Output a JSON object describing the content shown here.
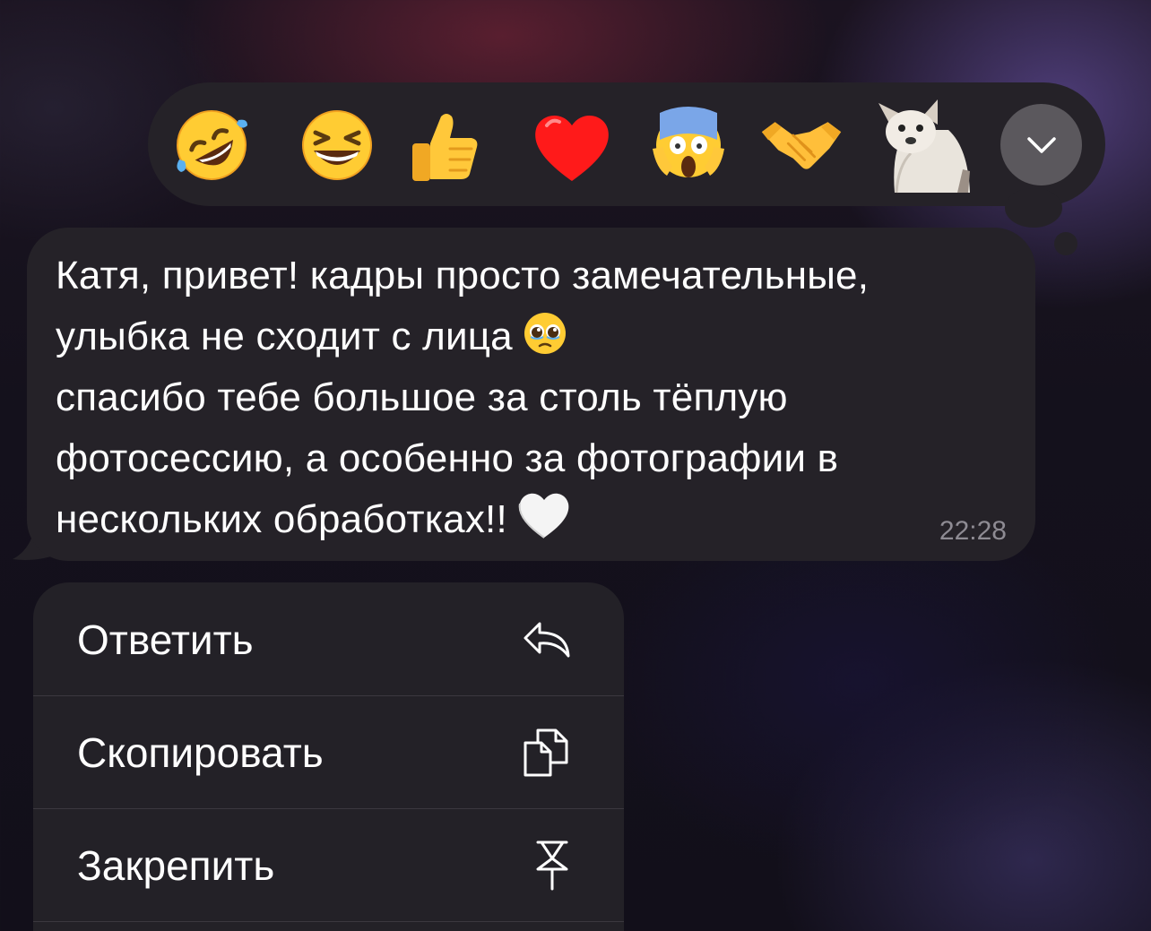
{
  "reactions": [
    {
      "name": "rolling-on-the-floor-laughing"
    },
    {
      "name": "grinning-squinting-face"
    },
    {
      "name": "thumbs-up"
    },
    {
      "name": "red-heart"
    },
    {
      "name": "face-screaming-in-fear"
    },
    {
      "name": "handshake"
    },
    {
      "name": "dog-sticker"
    }
  ],
  "message": {
    "lines": [
      "Катя, привет! кадры просто замечательные,",
      "улыбка не сходит с лица",
      "спасибо тебе большое за столь тёплую",
      "фотосессию, а особенно за фотографии в",
      "нескольких обработках!!"
    ],
    "inline_emojis": [
      "pleading-face",
      "white-heart"
    ],
    "time": "22:28"
  },
  "menu": {
    "items": [
      {
        "label": "Ответить",
        "icon": "reply-icon"
      },
      {
        "label": "Скопировать",
        "icon": "copy-icon"
      },
      {
        "label": "Закрепить",
        "icon": "pin-icon"
      }
    ]
  },
  "colors": {
    "bubble": "#252228",
    "menu": "#232127",
    "time": "#8e8b93",
    "expand_button": "#5b585d"
  }
}
